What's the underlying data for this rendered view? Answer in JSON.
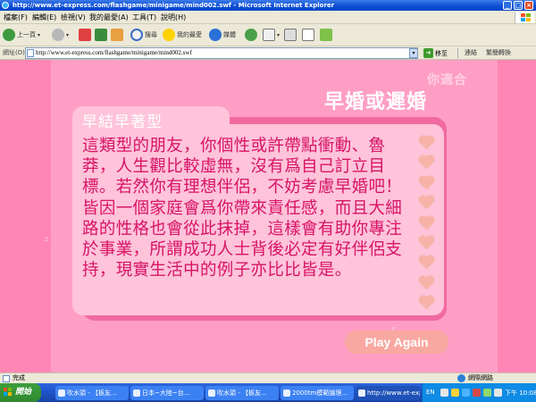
{
  "window": {
    "title": "http://www.et-express.com/flashgame/minigame/mind002.swf - Microsoft Internet Explorer",
    "min": "_",
    "max": "□",
    "close": "×"
  },
  "menu": [
    "檔案(F)",
    "編輯(E)",
    "檢視(V)",
    "我的最愛(A)",
    "工具(T)",
    "說明(H)"
  ],
  "toolbar": {
    "back": "上一頁",
    "search": "搜尋",
    "favorites": "我的最愛",
    "media": "媒體"
  },
  "address": {
    "label": "網址(D)",
    "url": "http://www.et-express.com/flashgame/minigame/mind002.swf",
    "go": "移至",
    "links": "連結",
    "translate": "繁簡轉換"
  },
  "flash": {
    "headline_small": "你適合",
    "headline_big": "早婚或遲婚",
    "card_title": "早結早著型",
    "card_text": "這類型的朋友，你個性或許帶點衝動、魯莽，人生觀比較虛無，沒有爲自己訂立目標。若然你有理想伴侶，不妨考慮早婚吧！皆因一個家庭會爲你帶來責任感，而且大細路的性格也會從此抹掉，這樣會有助你專注於事業，所謂成功人士背後必定有好伴侶支持，現實生活中的例子亦比比皆是。",
    "play_again": "Play Again",
    "colors": {
      "background": "#ff86b4",
      "stage": "#ff9ec4",
      "card": "#ffc3da",
      "text": "#d71466",
      "heart": "#f7b3a8",
      "button": "#f8a8a0"
    }
  },
  "status": {
    "text": "完成",
    "zone": "網際網路"
  },
  "taskbar": {
    "start": "開始",
    "tasks": [
      "吹水頭 - 【板友...",
      "日本~大陸~台...",
      "吹水頭 - 【板友...",
      "2000tm模範論理...",
      "http://www.et-expr..."
    ],
    "lang": "EN",
    "clock": "下午 10:08"
  }
}
